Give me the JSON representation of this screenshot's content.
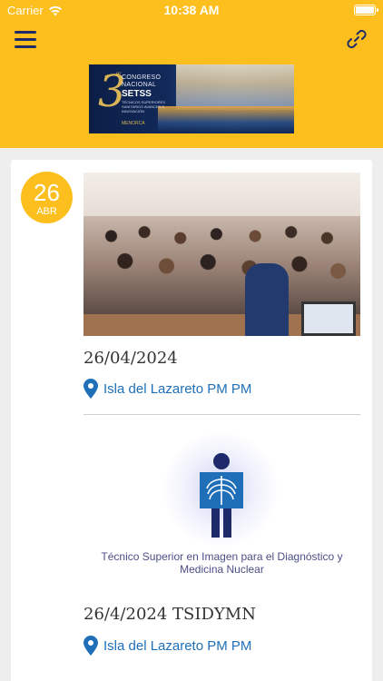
{
  "status_bar": {
    "carrier": "Carrier",
    "time": "10:38 AM"
  },
  "header": {
    "banner": {
      "number": "3",
      "superscript": "er",
      "line1": "CONGRESO",
      "line2": "NACIONAL",
      "line3": "SETSS",
      "line4": "TÉCNICOS SUPERIORES SANITARIOS AVANCES E INNOVACIÓN",
      "line5": "MENORCA"
    }
  },
  "events": [
    {
      "badge": {
        "day": "26",
        "month": "ABR"
      },
      "date": "26/04/2024",
      "location": "Isla del Lazareto PM PM"
    },
    {
      "logo_caption": "Técnico Superior en Imagen para el Diagnóstico y Medicina Nuclear",
      "date": "26/4/2024 TSIDYMN",
      "location": "Isla del Lazareto PM PM"
    }
  ],
  "colors": {
    "header_bg": "#fcbf1e",
    "accent_navy": "#1f2a6b",
    "link_blue": "#1e6fb8"
  }
}
